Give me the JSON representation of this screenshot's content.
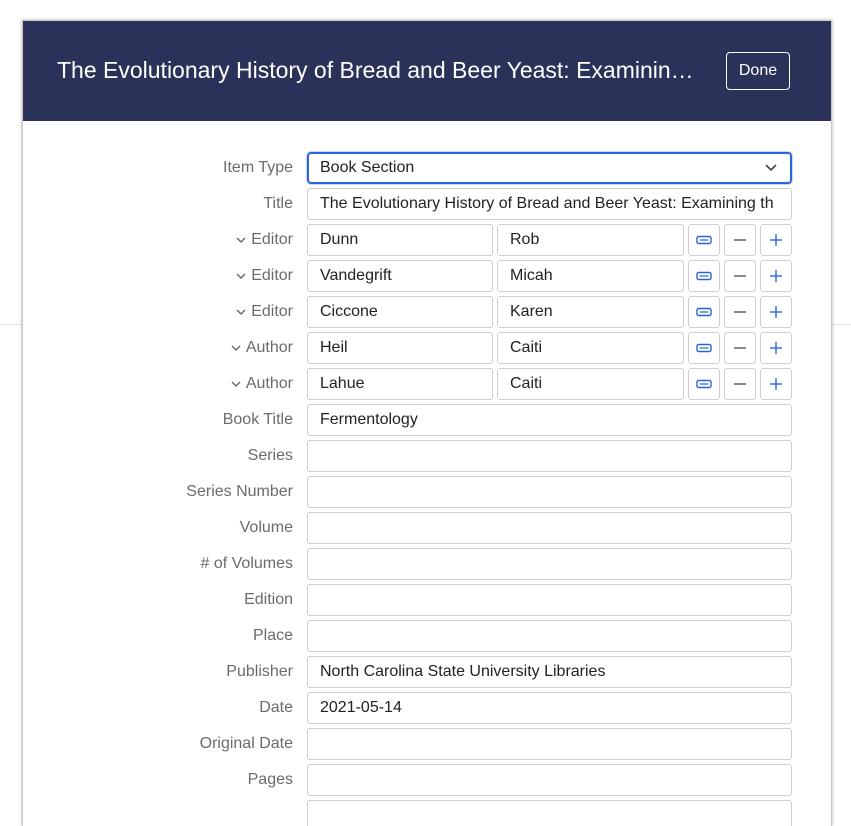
{
  "dialog": {
    "title": "The Evolutionary History of Bread and Beer Yeast: Examining the Domestication of Saccharomyces cerevisiae",
    "done_label": "Done"
  },
  "fields": {
    "item_type": {
      "label": "Item Type",
      "value": "Book Section"
    },
    "title": {
      "label": "Title",
      "value": "The Evolutionary History of Bread and Beer Yeast: Examining th"
    },
    "book_title": {
      "label": "Book Title",
      "value": "Fermentology"
    },
    "series": {
      "label": "Series",
      "value": ""
    },
    "series_number": {
      "label": "Series Number",
      "value": ""
    },
    "volume": {
      "label": "Volume",
      "value": ""
    },
    "num_volumes": {
      "label": "# of Volumes",
      "value": ""
    },
    "edition": {
      "label": "Edition",
      "value": ""
    },
    "place": {
      "label": "Place",
      "value": ""
    },
    "publisher": {
      "label": "Publisher",
      "value": "North Carolina State University Libraries"
    },
    "date": {
      "label": "Date",
      "value": "2021-05-14"
    },
    "original_date": {
      "label": "Original Date",
      "value": ""
    },
    "pages": {
      "label": "Pages",
      "value": ""
    }
  },
  "creators": [
    {
      "role": "Editor",
      "last": "Dunn",
      "first": "Rob"
    },
    {
      "role": "Editor",
      "last": "Vandegrift",
      "first": "Micah"
    },
    {
      "role": "Editor",
      "last": "Ciccone",
      "first": "Karen"
    },
    {
      "role": "Author",
      "last": "Heil",
      "first": "Caiti"
    },
    {
      "role": "Author",
      "last": "Lahue",
      "first": "Caiti"
    }
  ],
  "colors": {
    "header_bg": "#2b3259",
    "accent": "#2a66d9",
    "label": "#6b6b6b"
  }
}
